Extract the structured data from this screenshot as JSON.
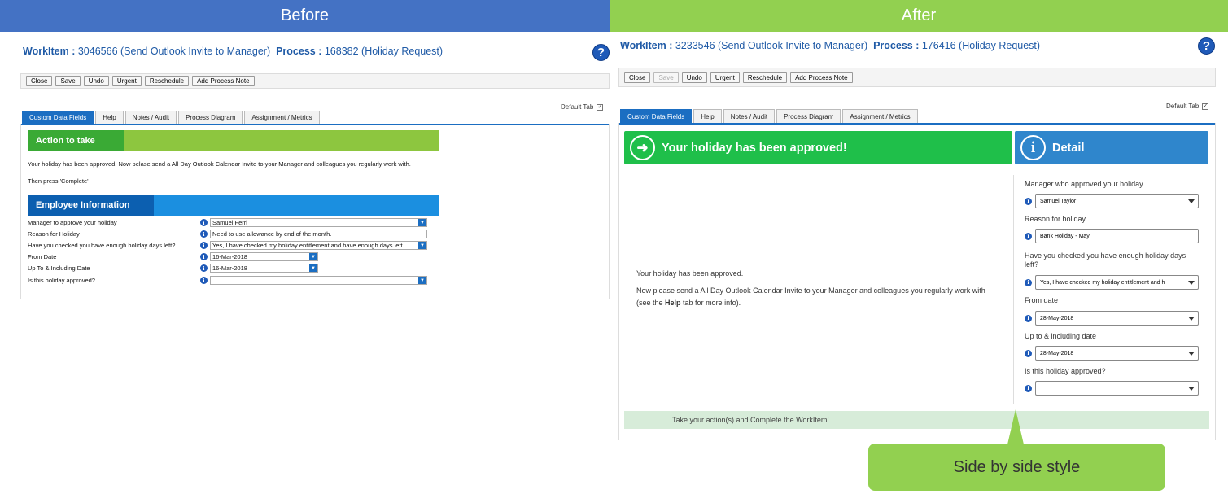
{
  "headers": {
    "before": "Before",
    "after": "After"
  },
  "before": {
    "workitem_label": "WorkItem :",
    "workitem_value": "3046566 (Send Outlook Invite to Manager)",
    "process_label": "Process :",
    "process_value": "168382 (Holiday Request)",
    "help_glyph": "?",
    "toolbar": [
      "Close",
      "Save",
      "Undo",
      "Urgent",
      "Reschedule",
      "Add Process Note"
    ],
    "default_tab_label": "Default Tab",
    "default_tab_check": "✓",
    "tabs": [
      "Custom Data Fields",
      "Help",
      "Notes / Audit",
      "Process Diagram",
      "Assignment / Metrics"
    ],
    "action_heading": "Action to take",
    "action_text": "Your holiday has been approved. Now pelase send a All Day Outlook Calendar Invite to your Manager and colleagues you regularly work with.",
    "then_text": "Then press 'Complete'",
    "employee_heading": "Employee Information",
    "info_glyph": "i",
    "dd_glyph": "▼",
    "fields": [
      {
        "label": "Manager to approve your holiday",
        "value": "Samuel Ferri"
      },
      {
        "label": "Reason for Holiday",
        "value": "Need to use allowance by end of the month."
      },
      {
        "label": "Have you checked you have enough holiday days left?",
        "value": "Yes, I have checked my holiday entitlement and have enough days left"
      },
      {
        "label": "From Date",
        "value": "16-Mar-2018"
      },
      {
        "label": "Up To & Including Date",
        "value": "16-Mar-2018"
      },
      {
        "label": "Is this holiday approved?",
        "value": ""
      }
    ]
  },
  "after": {
    "workitem_label": "WorkItem :",
    "workitem_value": "3233546 (Send Outlook Invite to Manager)",
    "process_label": "Process :",
    "process_value": "176416 (Holiday Request)",
    "help_glyph": "?",
    "toolbar": [
      "Close",
      "Save",
      "Undo",
      "Urgent",
      "Reschedule",
      "Add Process Note"
    ],
    "default_tab_label": "Default Tab",
    "default_tab_check": "✓",
    "tabs": [
      "Custom Data Fields",
      "Help",
      "Notes / Audit",
      "Process Diagram",
      "Assignment / Metrics"
    ],
    "approved_heading": "Your holiday has been approved!",
    "approved_glyph": "➜",
    "detail_heading": "Detail",
    "detail_glyph": "i",
    "info_glyph": "i",
    "msg1": "Your holiday has been approved.",
    "msg2_pre": "Now please send a All Day Outlook Calendar Invite to your Manager and colleagues you regularly work with (see the ",
    "msg2_bold": "Help",
    "msg2_post": " tab for more info).",
    "fields": [
      {
        "label": "Manager who approved your holiday",
        "value": "Samuel Taylor"
      },
      {
        "label": "Reason for holiday",
        "value": "Bank Holiday - May"
      },
      {
        "label": "Have you checked you have enough holiday days left?",
        "value": "Yes, I have checked my holiday entitlement and h"
      },
      {
        "label": "From date",
        "value": "28-May-2018"
      },
      {
        "label": "Up to & including date",
        "value": "28-May-2018"
      },
      {
        "label": "Is this holiday approved?",
        "value": ""
      }
    ],
    "footer": "Take your action(s) and Complete the WorkItem!"
  },
  "callout": "Side by side style",
  "colors": {
    "before_header": "#4472c4",
    "after_header": "#92d050",
    "tab_blue": "#1b6ec2",
    "green_bar": "#1fbf4a",
    "blue_bar": "#2f86cc"
  }
}
